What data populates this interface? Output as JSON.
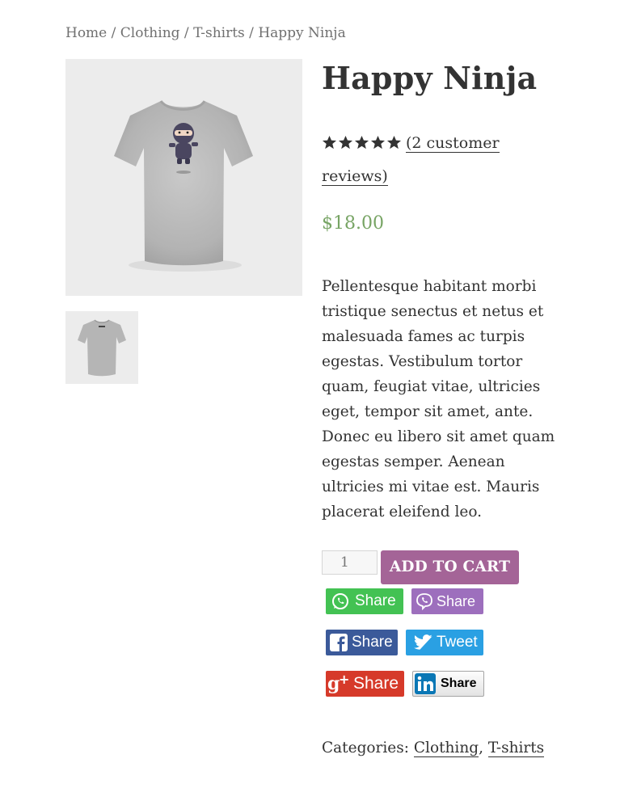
{
  "breadcrumb": {
    "home": "Home",
    "sep1": " / ",
    "clothing": "Clothing",
    "sep2": " / ",
    "tshirts": "T-shirts",
    "sep3": " / ",
    "current": "Happy Ninja"
  },
  "product": {
    "title": "Happy Ninja",
    "rating_stars": 5,
    "reviews_link": "(2 customer reviews)",
    "price": "$18.00",
    "description": "Pellentesque habitant morbi tristique senectus et netus et malesuada fames ac turpis egestas. Vestibulum tortor quam, feugiat vitae, ultricies eget, tempor sit amet, ante. Donec eu libero sit amet quam egestas semper. Aenean ultricies mi vitae est. Mauris placerat eleifend leo."
  },
  "cart": {
    "quantity": "1",
    "add_to_cart_label": "ADD TO CART"
  },
  "share": {
    "whatsapp": "Share",
    "viber": "Share",
    "facebook": "Share",
    "twitter": "Tweet",
    "google": "Share",
    "linkedin": "Share"
  },
  "meta": {
    "categories_label": "Categories:",
    "category_1": "Clothing",
    "category_sep": ", ",
    "category_2": "T-shirts"
  },
  "colors": {
    "price": "#77a464",
    "add_to_cart": "#a46497",
    "whatsapp": "#43c253",
    "viber": "#9d6fbd",
    "facebook": "#3b5a9a",
    "twitter": "#2aa0e3",
    "google": "#d63a2a"
  }
}
